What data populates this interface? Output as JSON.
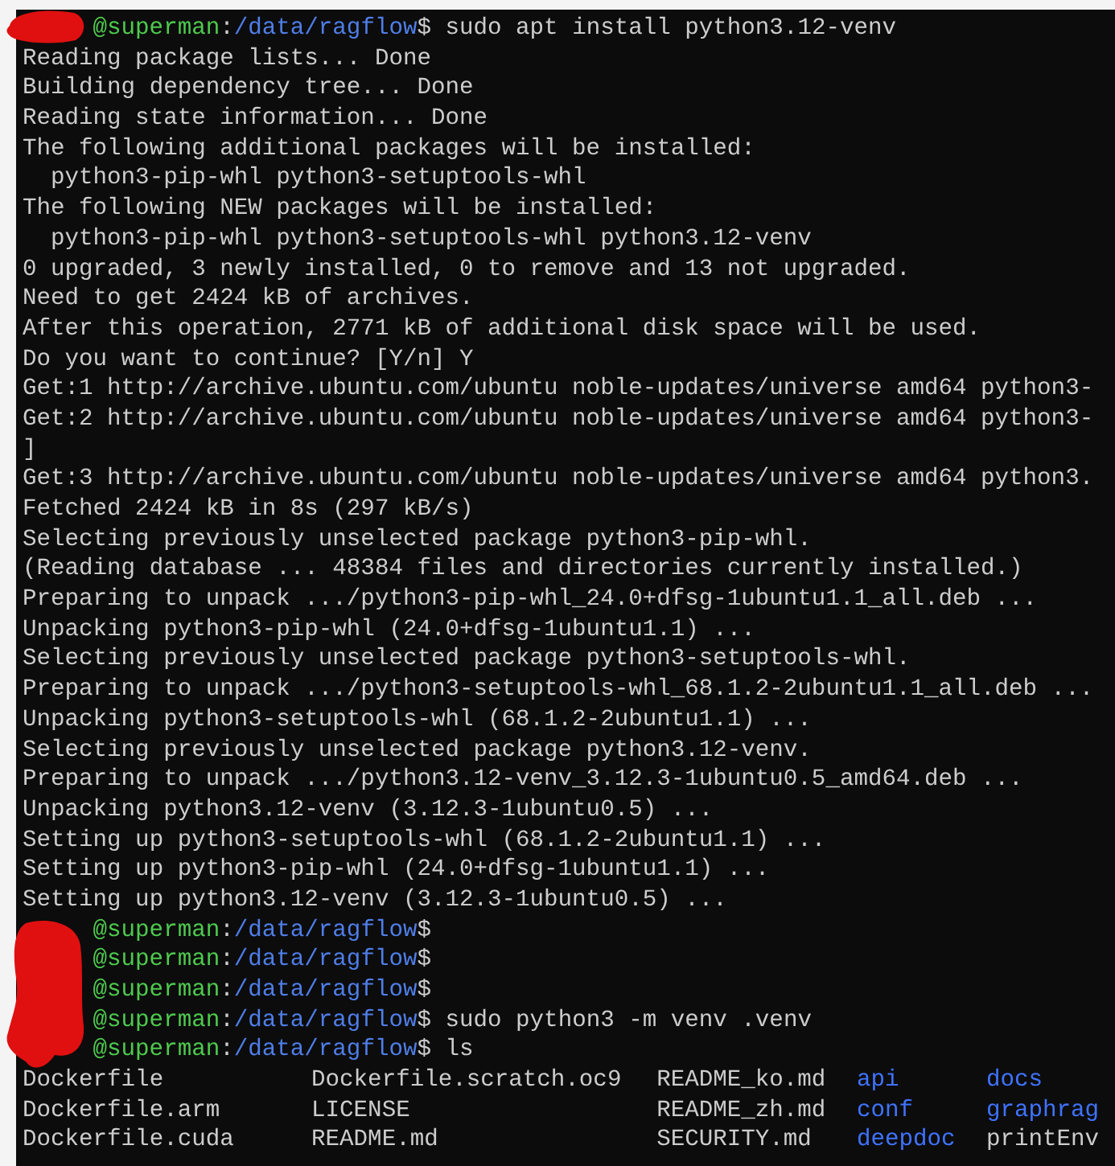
{
  "terminal": {
    "lines": [
      {
        "kind": "prompt",
        "host": "@superman",
        "separator": ":",
        "path": "/data/ragflow",
        "prompt_char": "$",
        "command": " sudo apt install python3.12-venv"
      },
      {
        "kind": "output",
        "text": "Reading package lists... Done"
      },
      {
        "kind": "output",
        "text": "Building dependency tree... Done"
      },
      {
        "kind": "output",
        "text": "Reading state information... Done"
      },
      {
        "kind": "output",
        "text": "The following additional packages will be installed:"
      },
      {
        "kind": "output",
        "text": "  python3-pip-whl python3-setuptools-whl"
      },
      {
        "kind": "output",
        "text": "The following NEW packages will be installed:"
      },
      {
        "kind": "output",
        "text": "  python3-pip-whl python3-setuptools-whl python3.12-venv"
      },
      {
        "kind": "output",
        "text": "0 upgraded, 3 newly installed, 0 to remove and 13 not upgraded."
      },
      {
        "kind": "output",
        "text": "Need to get 2424 kB of archives."
      },
      {
        "kind": "output",
        "text": "After this operation, 2771 kB of additional disk space will be used."
      },
      {
        "kind": "output",
        "text": "Do you want to continue? [Y/n] Y"
      },
      {
        "kind": "output",
        "text": "Get:1 http://archive.ubuntu.com/ubuntu noble-updates/universe amd64 python3-"
      },
      {
        "kind": "output",
        "text": "Get:2 http://archive.ubuntu.com/ubuntu noble-updates/universe amd64 python3-"
      },
      {
        "kind": "output",
        "text": "]"
      },
      {
        "kind": "output",
        "text": "Get:3 http://archive.ubuntu.com/ubuntu noble-updates/universe amd64 python3."
      },
      {
        "kind": "output",
        "text": "Fetched 2424 kB in 8s (297 kB/s)"
      },
      {
        "kind": "output",
        "text": "Selecting previously unselected package python3-pip-whl."
      },
      {
        "kind": "output",
        "text": "(Reading database ... 48384 files and directories currently installed.)"
      },
      {
        "kind": "output",
        "text": "Preparing to unpack .../python3-pip-whl_24.0+dfsg-1ubuntu1.1_all.deb ..."
      },
      {
        "kind": "output",
        "text": "Unpacking python3-pip-whl (24.0+dfsg-1ubuntu1.1) ..."
      },
      {
        "kind": "output",
        "text": "Selecting previously unselected package python3-setuptools-whl."
      },
      {
        "kind": "output",
        "text": "Preparing to unpack .../python3-setuptools-whl_68.1.2-2ubuntu1.1_all.deb ..."
      },
      {
        "kind": "output",
        "text": "Unpacking python3-setuptools-whl (68.1.2-2ubuntu1.1) ..."
      },
      {
        "kind": "output",
        "text": "Selecting previously unselected package python3.12-venv."
      },
      {
        "kind": "output",
        "text": "Preparing to unpack .../python3.12-venv_3.12.3-1ubuntu0.5_amd64.deb ..."
      },
      {
        "kind": "output",
        "text": "Unpacking python3.12-venv (3.12.3-1ubuntu0.5) ..."
      },
      {
        "kind": "output",
        "text": "Setting up python3-setuptools-whl (68.1.2-2ubuntu1.1) ..."
      },
      {
        "kind": "output",
        "text": "Setting up python3-pip-whl (24.0+dfsg-1ubuntu1.1) ..."
      },
      {
        "kind": "output",
        "text": "Setting up python3.12-venv (3.12.3-1ubuntu0.5) ..."
      },
      {
        "kind": "prompt",
        "host": "@superman",
        "separator": ":",
        "path": "/data/ragflow",
        "prompt_char": "$"
      },
      {
        "kind": "prompt",
        "host": "@superman",
        "separator": ":",
        "path": "/data/ragflow",
        "prompt_char": "$"
      },
      {
        "kind": "prompt",
        "host": "@superman",
        "separator": ":",
        "path": "/data/ragflow",
        "prompt_char": "$"
      },
      {
        "kind": "prompt",
        "host": "@superman",
        "separator": ":",
        "path": "/data/ragflow",
        "prompt_char": "$",
        "command": " sudo python3 -m venv .venv"
      },
      {
        "kind": "prompt",
        "host": "@superman",
        "separator": ":",
        "path": "/data/ragflow",
        "prompt_char": "$",
        "command": " ls"
      },
      {
        "kind": "listing",
        "entries": [
          {
            "name": "Dockerfile",
            "directory": false
          },
          {
            "name": "Dockerfile.scratch.oc9",
            "directory": false
          },
          {
            "name": "README_ko.md",
            "directory": false
          },
          {
            "name": "api",
            "directory": true
          },
          {
            "name": "docs",
            "directory": true
          }
        ]
      },
      {
        "kind": "listing",
        "entries": [
          {
            "name": "Dockerfile.arm",
            "directory": false
          },
          {
            "name": "LICENSE",
            "directory": false
          },
          {
            "name": "README_zh.md",
            "directory": false
          },
          {
            "name": "conf",
            "directory": true
          },
          {
            "name": "graphrag",
            "directory": true
          }
        ]
      },
      {
        "kind": "listing",
        "entries": [
          {
            "name": "Dockerfile.cuda",
            "directory": false
          },
          {
            "name": "README.md",
            "directory": false
          },
          {
            "name": "SECURITY.md",
            "directory": false
          },
          {
            "name": "deepdoc",
            "directory": true
          },
          {
            "name": "printEnv",
            "directory": false
          }
        ]
      }
    ]
  }
}
